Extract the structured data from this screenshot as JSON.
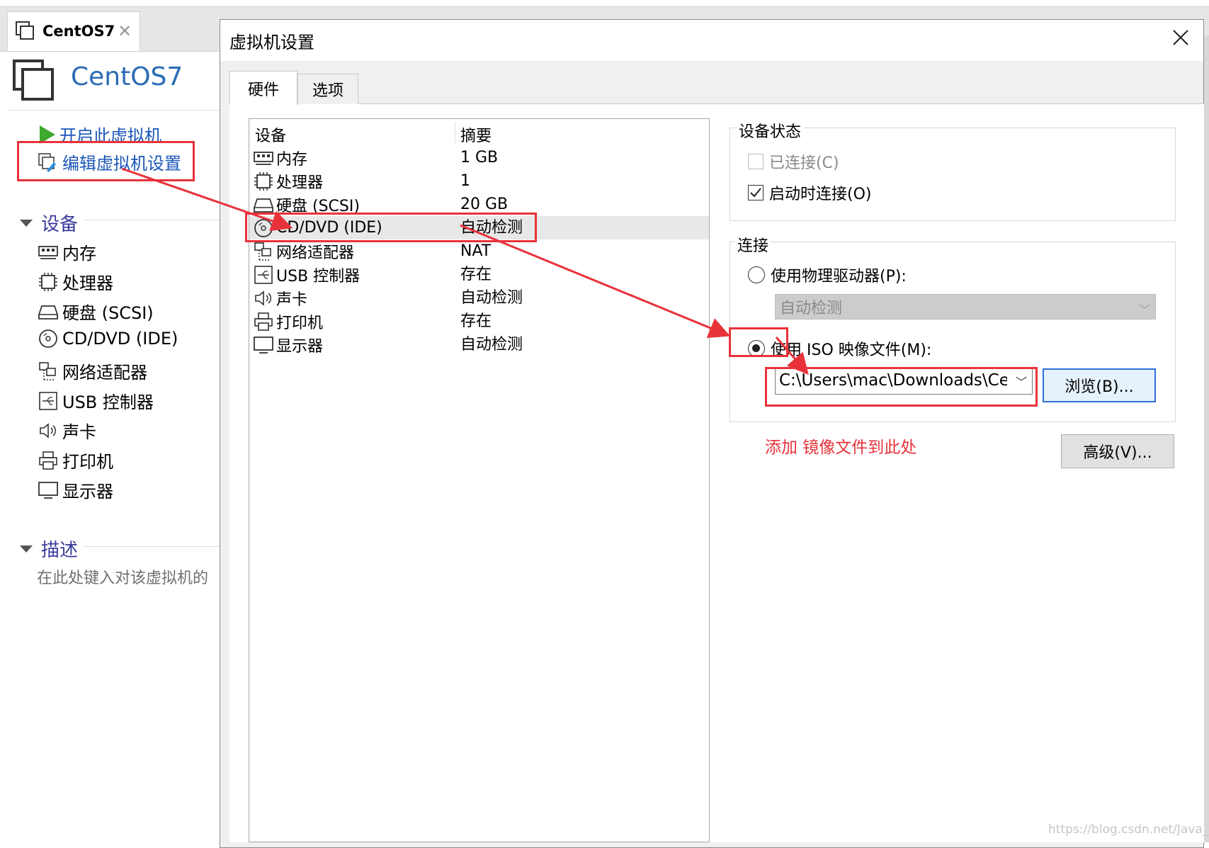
{
  "app": {
    "tab_label": "CentOS7",
    "vm_title": "CentOS7"
  },
  "sidebar": {
    "power_on": "开启此虚拟机",
    "edit_settings": "编辑虚拟机设置",
    "devices_heading": "设备",
    "devices": [
      {
        "label": "内存",
        "icon": "memory-icon"
      },
      {
        "label": "处理器",
        "icon": "processor-icon"
      },
      {
        "label": "硬盘 (SCSI)",
        "icon": "hard-disk-icon"
      },
      {
        "label": "CD/DVD (IDE)",
        "icon": "cd-dvd-icon"
      },
      {
        "label": "网络适配器",
        "icon": "network-adapter-icon"
      },
      {
        "label": "USB 控制器",
        "icon": "usb-controller-icon"
      },
      {
        "label": "声卡",
        "icon": "sound-card-icon"
      },
      {
        "label": "打印机",
        "icon": "printer-icon"
      },
      {
        "label": "显示器",
        "icon": "display-icon"
      }
    ],
    "description_heading": "描述",
    "description_placeholder": "在此处键入对该虚拟机的"
  },
  "dialog": {
    "title": "虚拟机设置",
    "tabs": [
      {
        "label": "硬件",
        "active": true
      },
      {
        "label": "选项",
        "active": false
      }
    ],
    "columns": {
      "device": "设备",
      "summary": "摘要"
    },
    "devices": [
      {
        "name": "内存",
        "summary": "1 GB",
        "icon": "memory-icon"
      },
      {
        "name": "处理器",
        "summary": "1",
        "icon": "processor-icon"
      },
      {
        "name": "硬盘 (SCSI)",
        "summary": "20 GB",
        "icon": "hard-disk-icon"
      },
      {
        "name": "CD/DVD (IDE)",
        "summary": "自动检测",
        "icon": "cd-dvd-icon",
        "selected": true
      },
      {
        "name": "网络适配器",
        "summary": "NAT",
        "icon": "network-adapter-icon"
      },
      {
        "name": "USB 控制器",
        "summary": "存在",
        "icon": "usb-controller-icon"
      },
      {
        "name": "声卡",
        "summary": "自动检测",
        "icon": "sound-card-icon"
      },
      {
        "name": "打印机",
        "summary": "存在",
        "icon": "printer-icon"
      },
      {
        "name": "显示器",
        "summary": "自动检测",
        "icon": "display-icon"
      }
    ],
    "device_status": {
      "label": "设备状态",
      "connected": "已连接(C)",
      "connected_checked": false,
      "connected_enabled": false,
      "connect_on_start": "启动时连接(O)",
      "connect_on_start_checked": true
    },
    "connection": {
      "label": "连接",
      "use_physical": "使用物理驱动器(P):",
      "physical_value": "自动检测",
      "use_iso": "使用 ISO 映像文件(M):",
      "iso_path": "C:\\Users\\mac\\Downloads\\CentOS",
      "selected": "iso"
    },
    "browse_button": "浏览(B)...",
    "advanced_button": "高级(V)...",
    "annotation": "添加 镜像文件到此处"
  },
  "watermark": "https://blog.csdn.net/Java_stud",
  "colors": {
    "link_blue": "#1a56b8",
    "title_blue": "#2b6bb5",
    "annotation_red": "#e8323a",
    "play_green": "#3fa82f"
  }
}
